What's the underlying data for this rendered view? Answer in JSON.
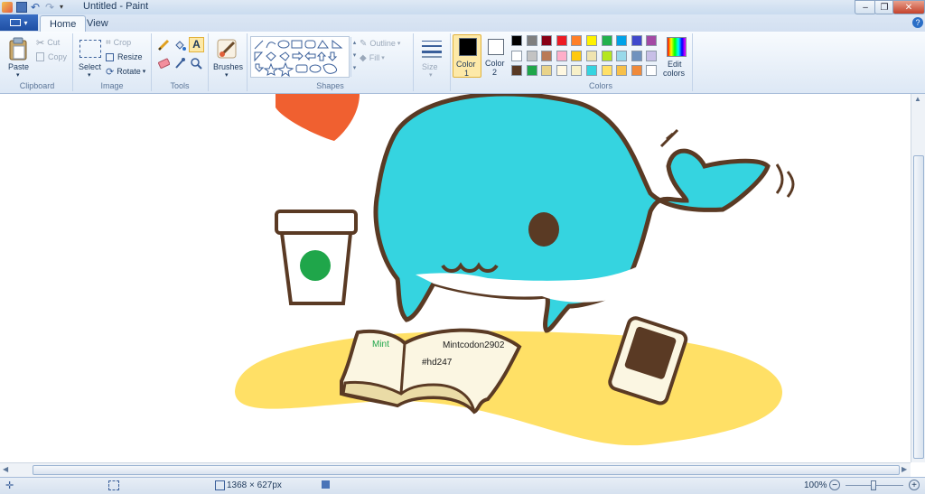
{
  "window": {
    "title": "Untitled - Paint"
  },
  "tabs": {
    "file": "",
    "home": "Home",
    "view": "View"
  },
  "ribbon": {
    "clipboard": {
      "paste": "Paste",
      "cut": "Cut",
      "copy": "Copy",
      "label": "Clipboard"
    },
    "image": {
      "select": "Select",
      "crop": "Crop",
      "resize": "Resize",
      "rotate": "Rotate",
      "label": "Image"
    },
    "tools": {
      "label": "Tools"
    },
    "brushes": {
      "label": "Brushes"
    },
    "shapes": {
      "outline": "Outline",
      "fill": "Fill",
      "label": "Shapes"
    },
    "size": {
      "label": "Size"
    },
    "color1": {
      "line1": "Color",
      "line2": "1",
      "value": "#000000"
    },
    "color2": {
      "line1": "Color",
      "line2": "2",
      "value": "#ffffff"
    },
    "colors": {
      "label": "Colors",
      "palette": [
        [
          "#000000",
          "#7f7f7f",
          "#880015",
          "#ed1c24",
          "#ff7f27",
          "#fff200",
          "#22b14c",
          "#00a2e8",
          "#3f48cc",
          "#a349a4"
        ],
        [
          "#ffffff",
          "#c3c3c3",
          "#b97a57",
          "#ffaec9",
          "#ffc90e",
          "#efe4b0",
          "#b5e61d",
          "#99d9ea",
          "#7092be",
          "#c8bfe7"
        ],
        [
          "#5a3a24",
          "#1fa64a",
          "#e8d38a",
          "#fff8e1",
          "#f7f0c8",
          "#35d4e0",
          "#ffe066",
          "#f7c04a",
          "#f08a3a",
          "#ffffff"
        ]
      ]
    },
    "edit_colors": {
      "line1": "Edit",
      "line2": "colors"
    }
  },
  "drawing": {
    "book_left_text": "Mint",
    "book_right_text": "Mintcodon2902",
    "book_right_sub": "#hd247",
    "colors": {
      "whale": "#35d4e0",
      "outline": "#5a3a24",
      "rug": "#ffe066",
      "logo": "#1fa64a",
      "heart": "#f06030"
    }
  },
  "status": {
    "dimensions": "1368 × 627px",
    "zoom": "100%"
  }
}
